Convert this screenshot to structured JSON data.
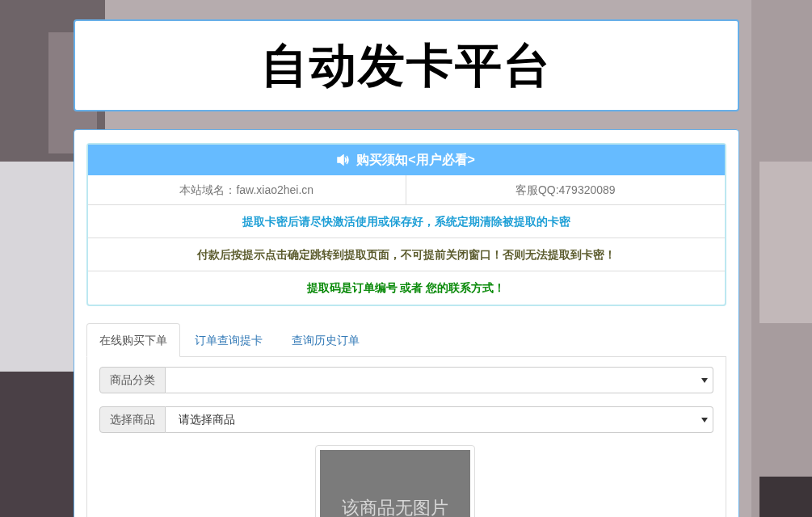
{
  "logo": {
    "text": "自动发卡平台"
  },
  "notice": {
    "title": "购买须知<用户必看>",
    "info": [
      "本站域名：faw.xiao2hei.cn",
      "客服QQ:479320089"
    ],
    "lines": [
      {
        "text": "提取卡密后请尽快激活使用或保存好，系统定期清除被提取的卡密",
        "color": "#1e9fd6"
      },
      {
        "text": "付款后按提示点击确定跳转到提取页面，不可提前关闭窗口！否则无法提取到卡密！",
        "color": "#5c5c2e"
      },
      {
        "text": "提取码是订单编号 或者 您的联系方式！",
        "color": "#0a8a0a"
      }
    ]
  },
  "tabs": [
    {
      "label": "在线购买下单",
      "selected": true
    },
    {
      "label": "订单查询提卡",
      "selected": false
    },
    {
      "label": "查询历史订单",
      "selected": false
    }
  ],
  "fields": [
    {
      "label": "商品分类"
    },
    {
      "label": "选择商品",
      "value": "请选择商品"
    }
  ],
  "product_image": {
    "text": "该商品无图片"
  }
}
